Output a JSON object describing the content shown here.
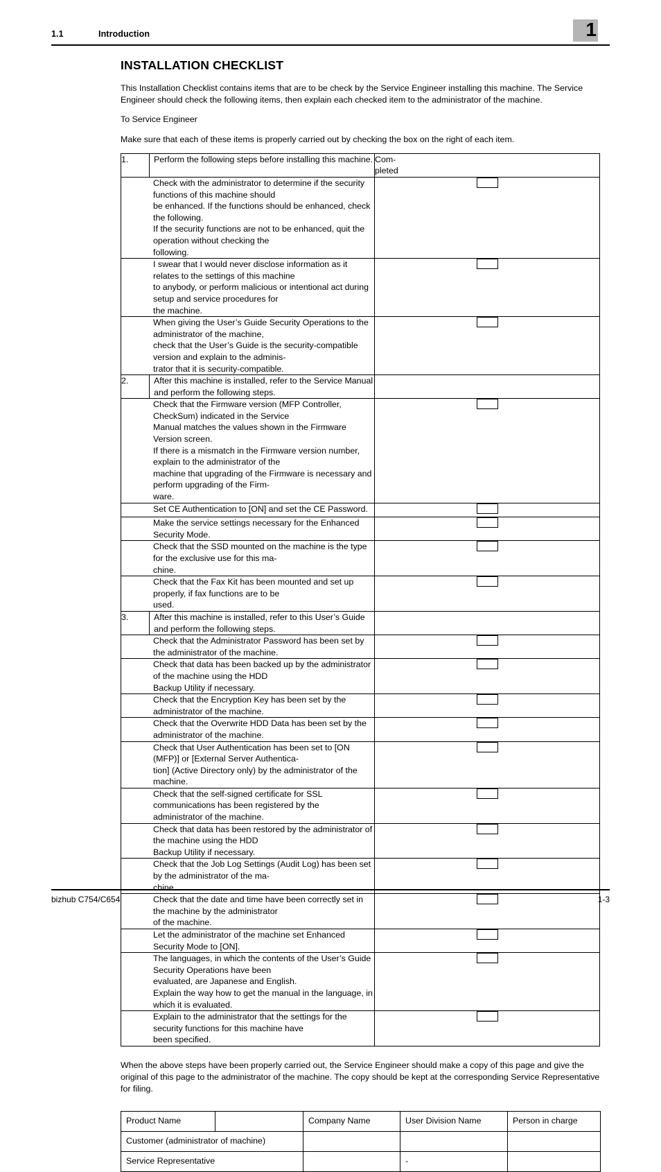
{
  "header": {
    "section_number": "1.1",
    "section_title": "Introduction",
    "chapter_number": "1"
  },
  "title": "INSTALLATION CHECKLIST",
  "intro_paragraphs": [
    "This Installation Checklist contains items that are to be check by the Service Engineer installing this machine. The Service Engineer should check the following items, then explain each checked item to the administrator of the machine.",
    "To Service Engineer",
    "Make sure that each of these items is properly carried out by checking the box on the right of each item."
  ],
  "checklist": {
    "completed_header_lines": [
      "Com-",
      "pleted"
    ],
    "rows": [
      {
        "num": "1.",
        "lines": [
          "Perform the following steps before installing this machine."
        ],
        "checkbox": false,
        "is_header_row": true
      },
      {
        "num": "",
        "lines": [
          "Check with the administrator to determine if the security functions of this machine should",
          "be enhanced. If the functions should be enhanced, check the following.",
          "If the security functions are not to be enhanced, quit the operation without checking the",
          "following."
        ],
        "checkbox": true
      },
      {
        "num": "",
        "lines": [
          "I swear that I would never disclose information as it relates to the settings of this machine",
          "to anybody, or perform malicious or intentional act during setup and service procedures for",
          "the machine."
        ],
        "checkbox": true
      },
      {
        "num": "",
        "lines": [
          "When giving the User’s Guide Security Operations to the administrator of the machine,",
          "check that the User’s Guide is the security-compatible version and explain to the adminis-",
          "trator that it is security-compatible."
        ],
        "checkbox": true
      },
      {
        "num": "2.",
        "lines": [
          "After this machine is installed, refer to the Service Manual and perform the following steps."
        ],
        "checkbox": false
      },
      {
        "num": "",
        "lines": [
          "Check that the Firmware version (MFP Controller, CheckSum) indicated in the Service",
          "Manual matches the values shown in the Firmware Version screen.",
          "If there is a mismatch in the Firmware version number, explain to the administrator of the",
          "machine that upgrading of the Firmware is necessary and perform upgrading of the Firm-",
          "ware."
        ],
        "checkbox": true
      },
      {
        "num": "",
        "lines": [
          "Set CE Authentication to [ON] and set the CE Password."
        ],
        "checkbox": true
      },
      {
        "num": "",
        "lines": [
          "Make the service settings necessary for the Enhanced Security Mode."
        ],
        "checkbox": true
      },
      {
        "num": "",
        "lines": [
          "Check that the SSD mounted on the machine is the type for the exclusive use for this ma-",
          "chine."
        ],
        "checkbox": true
      },
      {
        "num": "",
        "lines": [
          "Check that the Fax Kit has been mounted and set up properly, if fax functions are to be",
          "used."
        ],
        "checkbox": true
      },
      {
        "num": "3.",
        "lines": [
          "After this machine is installed, refer to this User’s Guide and perform the following steps."
        ],
        "checkbox": false
      },
      {
        "num": "",
        "lines": [
          "Check that the Administrator Password has been set by the administrator of the machine."
        ],
        "checkbox": true
      },
      {
        "num": "",
        "lines": [
          "Check that data has been backed up by the administrator of the machine using the HDD",
          "Backup Utility if necessary."
        ],
        "checkbox": true
      },
      {
        "num": "",
        "lines": [
          "Check that the Encryption Key has been set by the administrator of the machine."
        ],
        "checkbox": true
      },
      {
        "num": "",
        "lines": [
          "Check that the Overwrite HDD Data has been set by the administrator of the machine."
        ],
        "checkbox": true
      },
      {
        "num": "",
        "lines": [
          "Check that User Authentication has been set to [ON (MFP)] or [External Server Authentica-",
          "tion] (Active Directory only) by the administrator of the machine."
        ],
        "checkbox": true
      },
      {
        "num": "",
        "lines": [
          "Check that the self-signed certificate for SSL communications has been registered by the",
          "administrator of the machine."
        ],
        "checkbox": true
      },
      {
        "num": "",
        "lines": [
          "Check that data has been restored by the administrator of the machine using the HDD",
          "Backup Utility if necessary."
        ],
        "checkbox": true
      },
      {
        "num": "",
        "lines": [
          "Check that the Job Log Settings (Audit Log) has been set by the administrator of the ma-",
          "chine."
        ],
        "checkbox": true
      },
      {
        "num": "",
        "lines": [
          "Check that the date and time have been correctly set in the machine by the administrator",
          "of the machine."
        ],
        "checkbox": true
      },
      {
        "num": "",
        "lines": [
          "Let the administrator of the machine set Enhanced Security Mode to [ON]."
        ],
        "checkbox": true
      },
      {
        "num": "",
        "lines": [
          "The languages, in which the contents of the User’s Guide Security Operations have been",
          "evaluated, are Japanese and English.",
          "Explain the way how to get the manual in the language, in which it is evaluated."
        ],
        "checkbox": true
      },
      {
        "num": "",
        "lines": [
          "Explain to the administrator that the settings for the security functions for this machine have",
          "been specified."
        ],
        "checkbox": true
      }
    ]
  },
  "closing_paragraph": "When the above steps have been properly carried out, the Service Engineer should make a copy of this page and give the original of this page to the administrator of the machine. The copy should be kept at the corresponding Service Representative for filing.",
  "signature_table": {
    "rows": [
      {
        "cells": [
          "Product Name",
          "",
          "Company Name",
          "User Division Name",
          "Person in charge"
        ],
        "span_first": false
      },
      {
        "cells": [
          "Customer (administrator of machine)",
          "",
          "",
          ""
        ],
        "span_first": true
      },
      {
        "cells": [
          "Service Representative",
          "",
          "-",
          ""
        ],
        "span_first": true
      }
    ]
  },
  "footer": {
    "model": "bizhub C754/C654",
    "page_number": "1-3"
  }
}
